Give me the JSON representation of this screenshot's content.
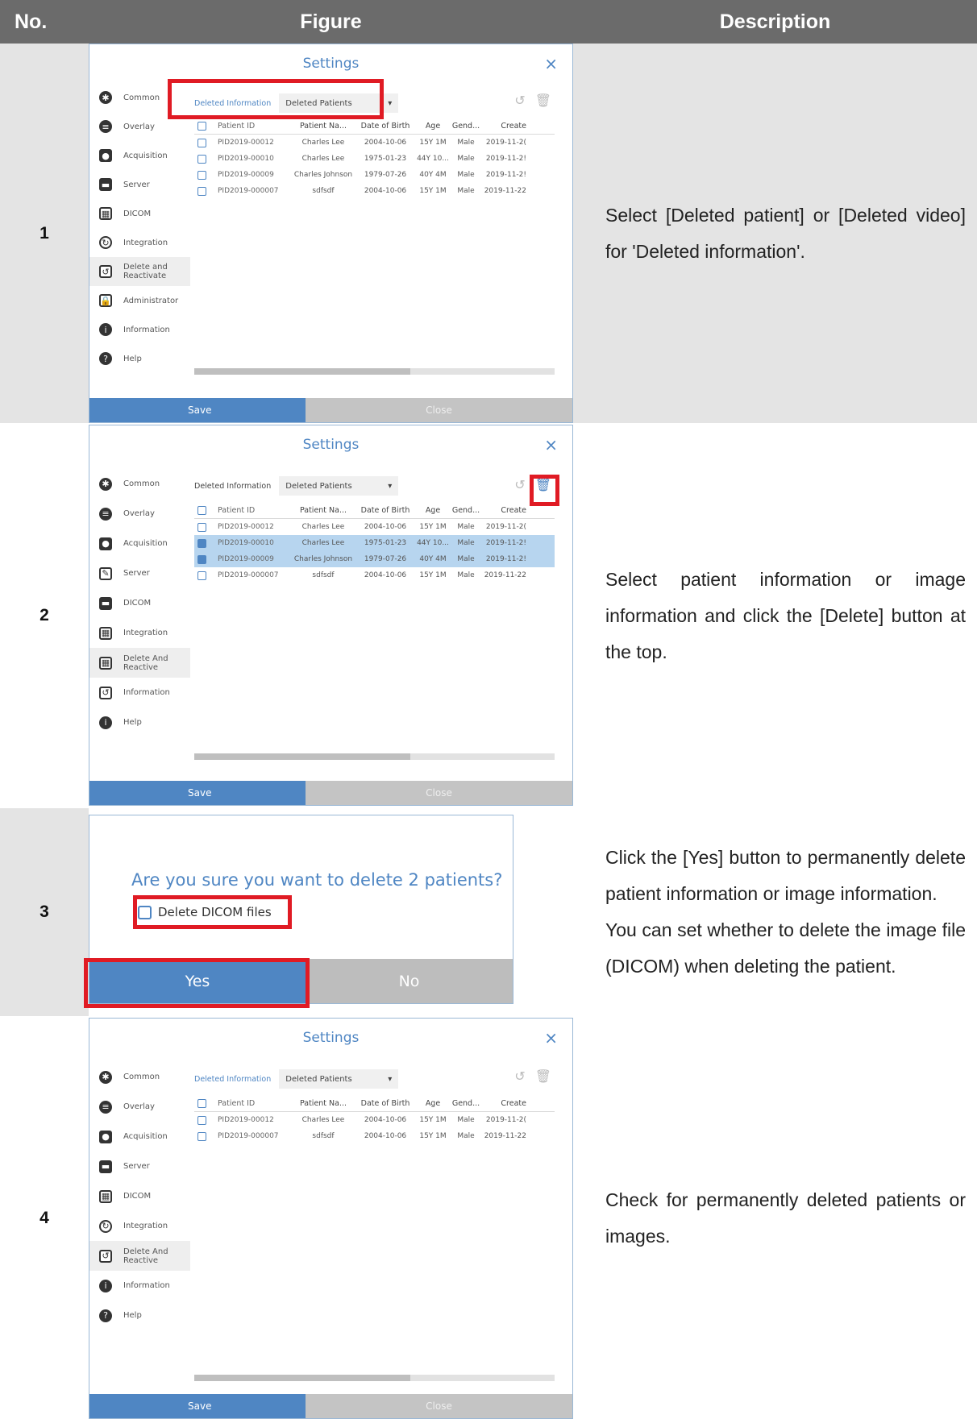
{
  "header": {
    "no": "No.",
    "figure": "Figure",
    "description": "Description"
  },
  "settings": {
    "title": "Settings",
    "close_glyph": "×",
    "deleted_info_label": "Deleted Information",
    "deleted_select_value": "Deleted Patients",
    "columns": [
      "Patient ID",
      "Patient Na...",
      "Date of Birth",
      "Age",
      "Gend...",
      "Create"
    ],
    "save": "Save",
    "close": "Close"
  },
  "rows": [
    {
      "no": "1",
      "description": "Select [Deleted patient] or [Deleted video] for 'Deleted information'.",
      "sidebar": [
        "Common",
        "Overlay",
        "Acquisition",
        "Server",
        "DICOM",
        "Integration",
        "Delete and Reactivate",
        "Administrator",
        "Information",
        "Help"
      ],
      "table": [
        [
          "PID2019-00012",
          "Charles Lee",
          "2004-10-06",
          "15Y 1M",
          "Male",
          "2019-11-2("
        ],
        [
          "PID2019-00010",
          "Charles Lee",
          "1975-01-23",
          "44Y 10...",
          "Male",
          "2019-11-2!"
        ],
        [
          "PID2019-00009",
          "Charles Johnson",
          "1979-07-26",
          "40Y 4M",
          "Male",
          "2019-11-2!"
        ],
        [
          "PID2019-000007",
          "sdfsdf",
          "2004-10-06",
          "15Y 1M",
          "Male",
          "2019-11-22"
        ]
      ]
    },
    {
      "no": "2",
      "description": "Select patient information or image information and click the [Delete] button at the top.",
      "sidebar": [
        "Common",
        "Overlay",
        "Acquisition",
        "Server",
        "DICOM",
        "Integration",
        "Delete And Reactive",
        "Information",
        "Help"
      ],
      "table": [
        [
          "PID2019-00012",
          "Charles Lee",
          "2004-10-06",
          "15Y 1M",
          "Male",
          "2019-11-2("
        ],
        [
          "PID2019-00010",
          "Charles Lee",
          "1975-01-23",
          "44Y 10...",
          "Male",
          "2019-11-2!"
        ],
        [
          "PID2019-00009",
          "Charles Johnson",
          "1979-07-26",
          "40Y 4M",
          "Male",
          "2019-11-2!"
        ],
        [
          "PID2019-000007",
          "sdfsdf",
          "2004-10-06",
          "15Y 1M",
          "Male",
          "2019-11-22"
        ]
      ]
    },
    {
      "no": "3",
      "description_lines": [
        "Click the [Yes] button to permanently delete patient information or image information.",
        "You can set whether to delete the image file (DICOM) when deleting the patient."
      ],
      "dialog": {
        "question": "Are you sure you want to delete 2 patients?",
        "checkbox": "Delete DICOM files",
        "yes": "Yes",
        "no": "No"
      }
    },
    {
      "no": "4",
      "description": "Check for permanently deleted patients or images.",
      "sidebar": [
        "Common",
        "Overlay",
        "Acquisition",
        "Server",
        "DICOM",
        "Integration",
        "Delete And Reactive",
        "Information",
        "Help"
      ],
      "table": [
        [
          "PID2019-00012",
          "Charles Lee",
          "2004-10-06",
          "15Y 1M",
          "Male",
          "2019-11-2("
        ],
        [
          "PID2019-000007",
          "sdfsdf",
          "2004-10-06",
          "15Y 1M",
          "Male",
          "2019-11-22"
        ]
      ]
    }
  ],
  "colors": {
    "accent": "#4f86c3",
    "highlight": "#e01b24",
    "header_bg": "#6b6b6b",
    "row_gray": "#e4e4e4",
    "selected_row": "#b7d5ef"
  }
}
